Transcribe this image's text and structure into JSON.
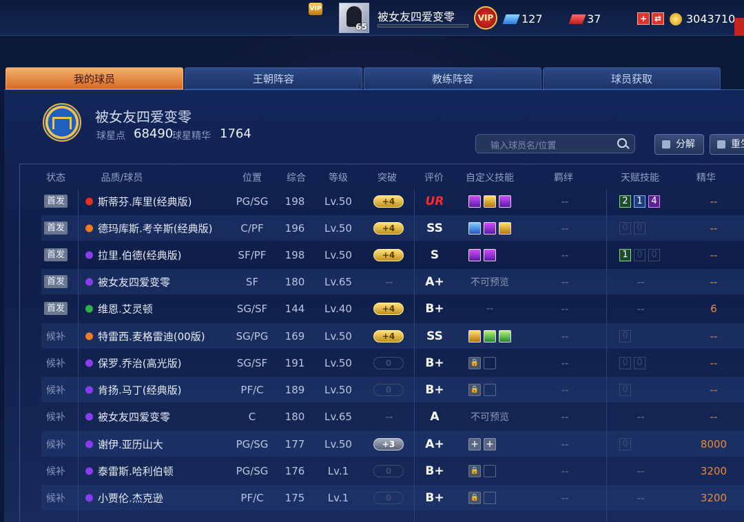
{
  "topbar": {
    "vip_small": "VIP",
    "player_name": "被女友四爱变零",
    "player_level": "65",
    "vip_label": "VIP",
    "diamonds": "127",
    "tickets": "37",
    "coins": "3043710"
  },
  "tabs": [
    {
      "label": "我的球员",
      "active": true
    },
    {
      "label": "王朝阵容",
      "active": false
    },
    {
      "label": "教练阵容",
      "active": false
    },
    {
      "label": "球员获取",
      "active": false
    }
  ],
  "team": {
    "name": "被女友四爱变零",
    "points_label": "球星点",
    "points": "68490",
    "essence_label": "球星精华",
    "essence": "1764"
  },
  "search": {
    "placeholder": "输入球员名/位置"
  },
  "buttons": {
    "decompose": "分解",
    "reset": "重生"
  },
  "headers": [
    "状态",
    "品质/球员",
    "位置",
    "综合",
    "等级",
    "突破",
    "评价",
    "自定义技能",
    "羁绊",
    "天赋技能",
    "精华"
  ],
  "rows": [
    {
      "status": "首发",
      "starter": true,
      "quality": "red",
      "name": "斯蒂芬.库里(经典版)",
      "pos": "PG/SG",
      "ovr": "198",
      "level": "Lv.50",
      "break": "+4",
      "break_type": "gold",
      "rating": "UR",
      "skills": [
        "p",
        "g",
        "p"
      ],
      "skill_text": "",
      "bond": "--",
      "talents": [
        {
          "v": "2",
          "c": "green"
        },
        {
          "v": "1",
          "c": "blue"
        },
        {
          "v": "4",
          "c": "purple"
        }
      ],
      "essence": "--"
    },
    {
      "status": "首发",
      "starter": true,
      "quality": "orange",
      "name": "德玛库斯.考辛斯(经典版)",
      "pos": "C/PF",
      "ovr": "196",
      "level": "Lv.50",
      "break": "+4",
      "break_type": "gold",
      "rating": "SS",
      "skills": [
        "b",
        "p",
        "g"
      ],
      "skill_text": "",
      "bond": "--",
      "talents": [
        {
          "v": "0",
          "c": "dim"
        },
        {
          "v": "0",
          "c": "dim"
        }
      ],
      "essence": "--"
    },
    {
      "status": "首发",
      "starter": true,
      "quality": "purple",
      "name": "拉里.伯德(经典版)",
      "pos": "SF/PF",
      "ovr": "198",
      "level": "Lv.50",
      "break": "+4",
      "break_type": "gold",
      "rating": "S",
      "skills": [
        "p",
        "p"
      ],
      "skill_text": "",
      "bond": "--",
      "talents": [
        {
          "v": "1",
          "c": "green"
        },
        {
          "v": "0",
          "c": "dim"
        },
        {
          "v": "0",
          "c": "dim"
        }
      ],
      "essence": "--"
    },
    {
      "status": "首发",
      "starter": true,
      "quality": "purple",
      "name": "被女友四爱变零",
      "pos": "SF",
      "ovr": "180",
      "level": "Lv.65",
      "break": "--",
      "break_type": "none",
      "rating": "A+",
      "skills": [],
      "skill_text": "不可预览",
      "bond": "--",
      "talents": [],
      "talent_text": "--",
      "essence": "--"
    },
    {
      "status": "首发",
      "starter": true,
      "quality": "green",
      "name": "维恩.艾灵顿",
      "pos": "SG/SF",
      "ovr": "144",
      "level": "Lv.40",
      "break": "+4",
      "break_type": "gold",
      "rating": "B+",
      "skills": [],
      "skill_text": "--",
      "bond": "--",
      "talents": [],
      "talent_text": "--",
      "essence": "6"
    },
    {
      "status": "候补",
      "starter": false,
      "quality": "orange",
      "name": "特雷西.麦格雷迪(00版)",
      "pos": "SG/PG",
      "ovr": "169",
      "level": "Lv.50",
      "break": "+4",
      "break_type": "gold",
      "rating": "SS",
      "skills": [
        "g",
        "gr",
        "gr"
      ],
      "skill_text": "",
      "bond": "--",
      "talents": [
        {
          "v": "0",
          "c": "dim"
        }
      ],
      "essence": "--"
    },
    {
      "status": "候补",
      "starter": false,
      "quality": "purple",
      "name": "保罗.乔治(高光版)",
      "pos": "SG/SF",
      "ovr": "191",
      "level": "Lv.50",
      "break": "0",
      "break_type": "empty",
      "rating": "B+",
      "skills": [
        "lock",
        "empty"
      ],
      "skill_text": "",
      "bond": "--",
      "talents": [
        {
          "v": "0",
          "c": "dim"
        },
        {
          "v": "0",
          "c": "dim"
        }
      ],
      "essence": "--"
    },
    {
      "status": "候补",
      "starter": false,
      "quality": "purple",
      "name": "肯扬.马丁(经典版)",
      "pos": "PF/C",
      "ovr": "189",
      "level": "Lv.50",
      "break": "0",
      "break_type": "empty",
      "rating": "B+",
      "skills": [
        "lock",
        "empty"
      ],
      "skill_text": "",
      "bond": "--",
      "talents": [
        {
          "v": "0",
          "c": "dim"
        }
      ],
      "essence": "--"
    },
    {
      "status": "候补",
      "starter": false,
      "quality": "purple",
      "name": "被女友四爱变零",
      "pos": "C",
      "ovr": "180",
      "level": "Lv.65",
      "break": "--",
      "break_type": "none",
      "rating": "A",
      "skills": [],
      "skill_text": "不可预览",
      "bond": "--",
      "talents": [],
      "talent_text": "--",
      "essence": "--"
    },
    {
      "status": "候补",
      "starter": false,
      "quality": "purple",
      "name": "谢伊.亚历山大",
      "pos": "PG/SG",
      "ovr": "177",
      "level": "Lv.50",
      "break": "+3",
      "break_type": "grey",
      "rating": "A+",
      "skills": [
        "plus",
        "plus"
      ],
      "skill_text": "",
      "bond": "--",
      "talents": [
        {
          "v": "0",
          "c": "dim"
        }
      ],
      "essence": "8000"
    },
    {
      "status": "候补",
      "starter": false,
      "quality": "purple",
      "name": "泰雷斯.哈利伯顿",
      "pos": "PG/SG",
      "ovr": "176",
      "level": "Lv.1",
      "break": "0",
      "break_type": "empty",
      "rating": "B+",
      "skills": [
        "lock",
        "empty"
      ],
      "skill_text": "",
      "bond": "--",
      "talents": [],
      "talent_text": "--",
      "essence": "3200"
    },
    {
      "status": "候补",
      "starter": false,
      "quality": "purple",
      "name": "小贾伦.杰克逊",
      "pos": "PF/C",
      "ovr": "175",
      "level": "Lv.1",
      "break": "0",
      "break_type": "empty",
      "rating": "B+",
      "skills": [
        "lock",
        "empty"
      ],
      "skill_text": "",
      "bond": "--",
      "talents": [],
      "talent_text": "--",
      "essence": "3200"
    }
  ],
  "colors": {
    "red": "#e0301e",
    "orange": "#f07a1e",
    "purple": "#8a3cf0",
    "green": "#2fb34a"
  }
}
